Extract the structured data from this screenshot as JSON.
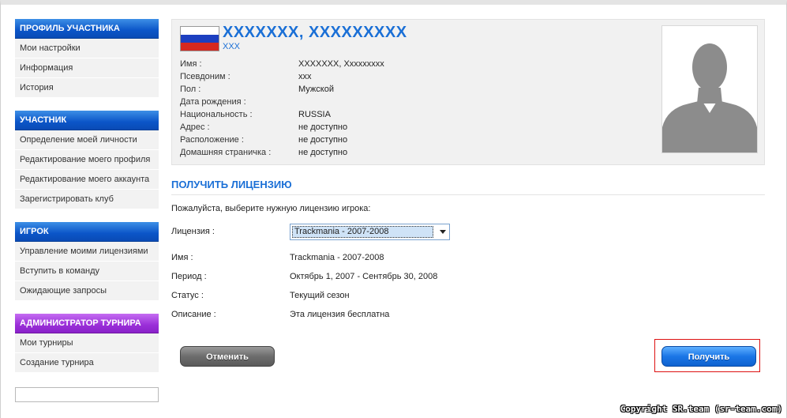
{
  "sidebar": {
    "sections": [
      {
        "title": "ПРОФИЛЬ УЧАСТНИКА",
        "color": "#0b55c8",
        "items": [
          "Мои настройки",
          "Информация",
          "История"
        ]
      },
      {
        "title": "УЧАСТНИК",
        "color": "#0b55c8",
        "items": [
          "Определение моей личности",
          "Редактирование моего профиля",
          "Редактирование моего аккаунта",
          "Зарегистрировать клуб"
        ]
      },
      {
        "title": "ИГРОК",
        "color": "#0b55c8",
        "items": [
          "Управление моими лицензиями",
          "Вступить в команду",
          "Ожидающие запросы"
        ]
      },
      {
        "title": "АДМИНИСТРАТОР ТУРНИРА",
        "color": "#9a2fd8",
        "items": [
          "Мои турниры",
          "Создание турнира"
        ]
      }
    ]
  },
  "profile": {
    "name": "XXXXXXX, XXXXXXXXX",
    "nickname": "XXX",
    "flag_icon": "russia-flag-icon",
    "avatar_icon": "default-avatar-icon",
    "fields": [
      {
        "label": "Имя :",
        "value": "XXXXXXX, Xxxxxxxxx"
      },
      {
        "label": "Псевдоним :",
        "value": "xxx"
      },
      {
        "label": "Пол :",
        "value": "Мужской"
      },
      {
        "label": "Дата рождения :",
        "value": ""
      },
      {
        "label": "Национальность :",
        "value": "RUSSIA"
      },
      {
        "label": "Адрес :",
        "value": "не доступно"
      },
      {
        "label": "Расположение :",
        "value": "не доступно"
      },
      {
        "label": "Домашняя страничка :",
        "value": "не доступно"
      }
    ]
  },
  "license": {
    "section_title": "ПОЛУЧИТЬ ЛИЦЕНЗИЮ",
    "prompt": "Пожалуйста, выберите нужную лицензию игрока:",
    "select_label": "Лицензия :",
    "select_value": "Trackmania - 2007-2008",
    "rows": [
      {
        "label": "Имя :",
        "value": "Trackmania - 2007-2008"
      },
      {
        "label": "Период :",
        "value": "Октябрь 1, 2007 - Сентябрь 30, 2008"
      },
      {
        "label": "Статус :",
        "value": "Текущий сезон"
      },
      {
        "label": "Описание :",
        "value": "Эта лицензия бесплатна"
      }
    ],
    "cancel_label": "Отменить",
    "get_label": "Получить"
  },
  "copyright": "Copyright SR.team (sr-team.com)",
  "colors": {
    "accent": "#1a6fd6",
    "highlight": "#dd1111"
  }
}
